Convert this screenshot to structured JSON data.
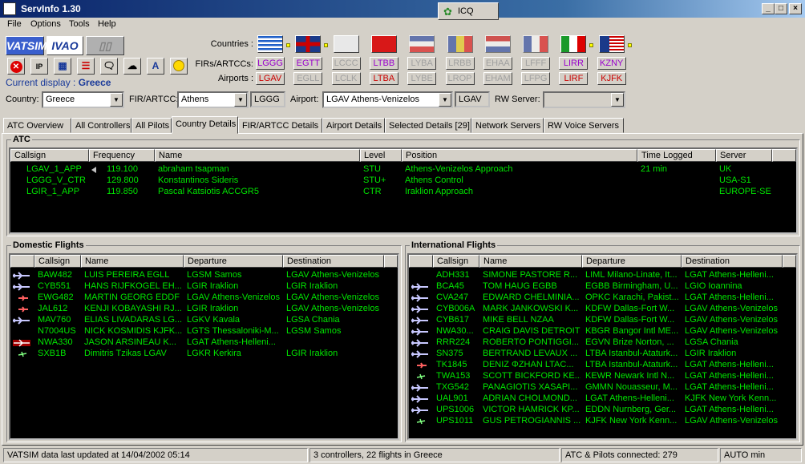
{
  "app": {
    "title": "ServInfo 1.30",
    "icq_label": "ICQ"
  },
  "menu": [
    "File",
    "Options",
    "Tools",
    "Help"
  ],
  "logos": {
    "vatsim": "VATSIM",
    "ivao": "IVAO"
  },
  "current_display": {
    "label": "Current display :",
    "value": "Greece"
  },
  "labels": {
    "countries": "Countries :",
    "firs": "FIRs/ARTCCs:",
    "airports": "Airports :",
    "country": "Country:",
    "fir": "FIR/ARTCC:",
    "airport": "Airport:",
    "rw": "RW Server:"
  },
  "countries": [
    {
      "name": "Greece",
      "fir": "LGGG",
      "airport": "LGAV",
      "fir_state": "act2",
      "ap_state": "act",
      "dot": true
    },
    {
      "name": "UK",
      "fir": "EGTT",
      "airport": "EGLL",
      "fir_state": "act2",
      "ap_state": "dis",
      "dot": true
    },
    {
      "name": "Cyprus",
      "fir": "LCCC",
      "airport": "LCLK",
      "fir_state": "dis",
      "ap_state": "dis",
      "dot": false
    },
    {
      "name": "Turkey",
      "fir": "LTBB",
      "airport": "LTBA",
      "fir_state": "act2",
      "ap_state": "act",
      "dot": false
    },
    {
      "name": "Yugoslavia",
      "fir": "LYBA",
      "airport": "LYBE",
      "fir_state": "dis",
      "ap_state": "dis",
      "dot": false
    },
    {
      "name": "Romania",
      "fir": "LRBB",
      "airport": "LROP",
      "fir_state": "dis",
      "ap_state": "dis",
      "dot": false
    },
    {
      "name": "Netherlands",
      "fir": "EHAA",
      "airport": "EHAM",
      "fir_state": "dis",
      "ap_state": "dis",
      "dot": false
    },
    {
      "name": "France",
      "fir": "LFFF",
      "airport": "LFPG",
      "fir_state": "dis",
      "ap_state": "dis",
      "dot": false
    },
    {
      "name": "Italy",
      "fir": "LIRR",
      "airport": "LIRF",
      "fir_state": "act2",
      "ap_state": "act",
      "dot": true
    },
    {
      "name": "USA",
      "fir": "KZNY",
      "airport": "KJFK",
      "fir_state": "act2",
      "ap_state": "act",
      "dot": true
    }
  ],
  "selectors": {
    "country": "Greece",
    "fir": "Athens",
    "fir_code": "LGGG",
    "airport": "LGAV Athens-Venizelos",
    "airport_code": "LGAV",
    "rw": ""
  },
  "tabs": [
    "ATC Overview",
    "All Controllers",
    "All Pilots",
    "Country Details",
    "FIR/ARTCC Details",
    "Airport Details",
    "Selected Details [29]",
    "Network Servers",
    "RW Voice Servers"
  ],
  "selected_tab": 3,
  "atc": {
    "title": "ATC",
    "columns": [
      "Callsign",
      "Frequency",
      "Name",
      "Level",
      "Position",
      "Time Logged",
      "Server"
    ],
    "rows": [
      [
        "LGAV_1_APP",
        "119.100",
        "abraham tsapman",
        "STU",
        "Athens-Venizelos Approach",
        "21 min",
        "UK"
      ],
      [
        "LGGG_V_CTR",
        "129.800",
        "Konstantinos Sideris",
        "STU+",
        "Athens Control",
        "",
        "USA-S1"
      ],
      [
        "LGIR_1_APP",
        "119.850",
        "Pascal Katsiotis ACCGR5",
        "CTR",
        "Iraklion Approach",
        "",
        "EUROPE-SE"
      ]
    ]
  },
  "domestic": {
    "title": "Domestic Flights",
    "columns": [
      "Callsign",
      "Name",
      "Departure",
      "Destination"
    ],
    "rows": [
      {
        "icon": "jet",
        "cells": [
          "BAW482",
          "LUIS PEREIRA EGLL",
          "LGSM Samos",
          "LGAV Athens-Venizelos"
        ]
      },
      {
        "icon": "jet",
        "cells": [
          "CYB551",
          "HANS RIJFKOGEL EH...",
          "LGIR Iraklion",
          "LGIR Iraklion"
        ]
      },
      {
        "icon": "small",
        "cells": [
          "EWG482",
          "MARTIN GEORG EDDF",
          "LGAV Athens-Venizelos",
          "LGAV Athens-Venizelos"
        ]
      },
      {
        "icon": "small",
        "cells": [
          "JAL612",
          "KENJI KOBAYASHI RJ...",
          "LGIR Iraklion",
          "LGAV Athens-Venizelos"
        ]
      },
      {
        "icon": "jet",
        "cells": [
          "MAV760",
          "ELIAS LIVADARAS LG...",
          "LGKV Kavala",
          "LGSA Chania"
        ]
      },
      {
        "icon": "none",
        "cells": [
          "N7004US",
          "NICK KOSMIDIS KJFK...",
          "LGTS Thessaloniki-M...",
          "LGSM Samos"
        ]
      },
      {
        "icon": "red",
        "cells": [
          "NWA330",
          "JASON ARSINEAU K...",
          "LGAT Athens-Helleni...",
          ""
        ]
      },
      {
        "icon": "glider",
        "cells": [
          "SXB1B",
          "Dimitris Tzikas LGAV",
          "LGKR Kerkira",
          "LGIR Iraklion"
        ]
      }
    ]
  },
  "international": {
    "title": "International Flights",
    "columns": [
      "Callsign",
      "Name",
      "Departure",
      "Destination"
    ],
    "rows": [
      {
        "icon": "none",
        "cells": [
          "ADH331",
          "SIMONE PASTORE R...",
          "LIML Milano-Linate, It...",
          "LGAT Athens-Helleni..."
        ]
      },
      {
        "icon": "jet",
        "cells": [
          "BCA45",
          "TOM HAUG EGBB",
          "EGBB Birmingham, U...",
          "LGIO Ioannina"
        ]
      },
      {
        "icon": "jet",
        "cells": [
          "CVA247",
          "EDWARD CHELMINIA...",
          "OPKC Karachi, Pakist...",
          "LGAT Athens-Helleni..."
        ]
      },
      {
        "icon": "jet",
        "cells": [
          "CYB006A",
          "MARK JANKOWSKI K...",
          "KDFW Dallas-Fort W...",
          "LGAV Athens-Venizelos"
        ]
      },
      {
        "icon": "jet",
        "cells": [
          "CYB617",
          "MIKE BELL NZAA",
          "KDFW Dallas-Fort W...",
          "LGAV Athens-Venizelos"
        ]
      },
      {
        "icon": "jet",
        "cells": [
          "NWA30...",
          "CRAIG DAVIS DETROIT",
          "KBGR Bangor Intl ME...",
          "LGAV Athens-Venizelos"
        ]
      },
      {
        "icon": "jet",
        "cells": [
          "RRR224",
          "ROBERTO PONTIGGI...",
          "EGVN Brize Norton, ...",
          "LGSA Chania"
        ]
      },
      {
        "icon": "jet",
        "cells": [
          "SN375",
          "BERTRAND LEVAUX ...",
          "LTBA Istanbul-Ataturk...",
          "LGIR Iraklion"
        ]
      },
      {
        "icon": "small",
        "cells": [
          "TK1845",
          "DENIZ ΦZHAN LTAC...",
          "LTBA Istanbul-Ataturk...",
          "LGAT Athens-Helleni..."
        ]
      },
      {
        "icon": "glider",
        "cells": [
          "TWA153",
          "SCOTT BICKFORD KE...",
          "KEWR Newark Intl N...",
          "LGAT Athens-Helleni..."
        ]
      },
      {
        "icon": "jet",
        "cells": [
          "TXG542",
          "PANAGIOTIS XASAPI...",
          "GMMN Nouasseur, M...",
          "LGAT Athens-Helleni..."
        ]
      },
      {
        "icon": "jet",
        "cells": [
          "UAL901",
          "ADRIAN CHOLMOND...",
          "LGAT Athens-Helleni...",
          "KJFK New York Kenn..."
        ]
      },
      {
        "icon": "jet",
        "cells": [
          "UPS1006",
          "VICTOR HAMRICK KP...",
          "EDDN Nurnberg, Ger...",
          "LGAT Athens-Helleni..."
        ]
      },
      {
        "icon": "glider",
        "cells": [
          "UPS1011",
          "GUS PETROGIANNIS ...",
          "KJFK New York Kenn...",
          "LGAV Athens-Venizelos"
        ]
      }
    ]
  },
  "status": {
    "updated": "VATSIM data last updated at 14/04/2002 05:14",
    "summary": "3 controllers, 22 flights in Greece",
    "connected": "ATC & Pilots connected: 279",
    "mode": "AUTO min"
  }
}
